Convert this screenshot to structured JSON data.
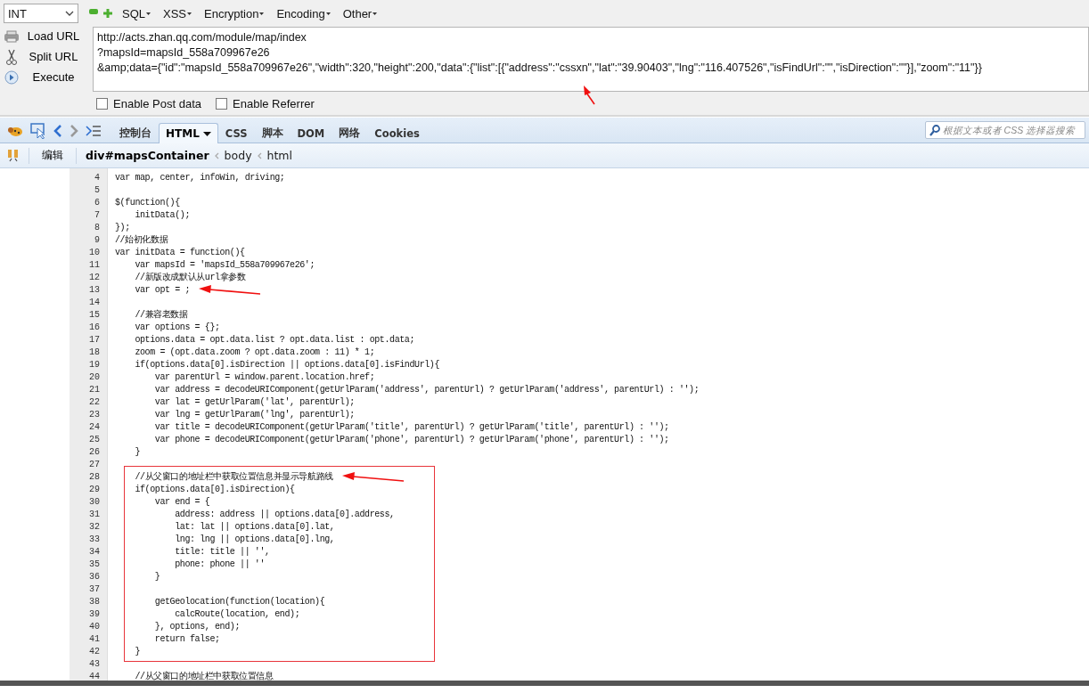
{
  "hackbar": {
    "select": {
      "value": "INT"
    },
    "menus": [
      "SQL",
      "XSS",
      "Encryption",
      "Encoding",
      "Other"
    ],
    "actions": [
      {
        "label": "Load URL",
        "kind": "load"
      },
      {
        "label": "Split URL",
        "kind": "split"
      },
      {
        "label": "Execute",
        "kind": "execute"
      }
    ],
    "url_lines": [
      "http://acts.zhan.qq.com/module/map/index",
      "?mapsId=mapsId_558a709967e26",
      "&amp;data={\"id\":\"mapsId_558a709967e26\",\"width\":320,\"height\":200,\"data\":{\"list\":[{\"address\":\"cssxn\",\"lat\":\"39.90403\",\"lng\":\"116.407526\",\"isFindUrl\":\"\",\"isDirection\":\"\"}],\"zoom\":\"11\"}}"
    ],
    "url_arrow": true,
    "options": [
      {
        "label": "Enable Post data",
        "checked": false
      },
      {
        "label": "Enable Referrer",
        "checked": false
      }
    ]
  },
  "firebug": {
    "tabs": [
      {
        "label": "控制台",
        "selected": false,
        "dropdown": false
      },
      {
        "label": "HTML",
        "selected": true,
        "dropdown": true
      },
      {
        "label": "CSS",
        "selected": false,
        "dropdown": false
      },
      {
        "label": "脚本",
        "selected": false,
        "dropdown": false
      },
      {
        "label": "DOM",
        "selected": false,
        "dropdown": false
      },
      {
        "label": "网络",
        "selected": false,
        "dropdown": false
      },
      {
        "label": "Cookies",
        "selected": false,
        "dropdown": false
      }
    ],
    "search": {
      "placeholder": "根据文本或者 CSS 选择器搜索"
    },
    "edit_button": "编辑",
    "breadcrumbs": [
      {
        "label": "div#mapsContainer",
        "selected": true
      },
      {
        "label": "body",
        "selected": false
      },
      {
        "label": "html",
        "selected": false
      }
    ]
  },
  "code": [
    {
      "kind": "plain",
      "lines": [
        {
          "num": "4",
          "text": "var map, center, infoWin, driving;"
        },
        {
          "num": "5"
        },
        {
          "num": "6",
          "text": "$(function(){"
        },
        {
          "num": "7",
          "text": "    initData();"
        },
        {
          "num": "8",
          "text": "});"
        },
        {
          "num": "9",
          "text": "//始初化数据"
        },
        {
          "num": "10",
          "text": "var initData = function(){"
        },
        {
          "num": "11",
          "text": "    var mapsId = 'mapsId_558a709967e26';"
        },
        {
          "num": "12",
          "text": "    //新版改成默认从url拿参数"
        },
        {
          "num": "13",
          "text": "    var opt = ;",
          "arrow": true
        },
        {
          "num": "14"
        },
        {
          "num": "15",
          "text": "    //兼容老数据"
        },
        {
          "num": "16",
          "text": "    var options = {};"
        },
        {
          "num": "17",
          "text": "    options.data = opt.data.list ? opt.data.list : opt.data;"
        },
        {
          "num": "18",
          "text": "    zoom = (opt.data.zoom ? opt.data.zoom : 11) * 1;"
        },
        {
          "num": "19",
          "text": "    if(options.data[0].isDirection || options.data[0].isFindUrl){"
        },
        {
          "num": "20",
          "text": "        var parentUrl = window.parent.location.href;"
        },
        {
          "num": "21",
          "text": "        var address = decodeURIComponent(getUrlParam('address', parentUrl) ? getUrlParam('address', parentUrl) : '');"
        },
        {
          "num": "22",
          "text": "        var lat = getUrlParam('lat', parentUrl);"
        },
        {
          "num": "23",
          "text": "        var lng = getUrlParam('lng', parentUrl);"
        },
        {
          "num": "24",
          "text": "        var title = decodeURIComponent(getUrlParam('title', parentUrl) ? getUrlParam('title', parentUrl) : '');"
        },
        {
          "num": "25",
          "text": "        var phone = decodeURIComponent(getUrlParam('phone', parentUrl) ? getUrlParam('phone', parentUrl) : '');"
        },
        {
          "num": "26",
          "text": "    }"
        },
        {
          "num": "27"
        }
      ]
    },
    {
      "kind": "boxed",
      "lines": [
        {
          "num": "28",
          "text": "    //从父窗口的地址栏中获取位置信息并显示导航路线",
          "arrow": true
        },
        {
          "num": "29",
          "text": "    if(options.data[0].isDirection){"
        },
        {
          "num": "30",
          "text": "        var end = {"
        },
        {
          "num": "31",
          "text": "            address: address || options.data[0].address,"
        },
        {
          "num": "32",
          "text": "            lat: lat || options.data[0].lat,"
        },
        {
          "num": "33",
          "text": "            lng: lng || options.data[0].lng,"
        },
        {
          "num": "34",
          "text": "            title: title || '',"
        },
        {
          "num": "35",
          "text": "            phone: phone || ''"
        },
        {
          "num": "36",
          "text": "        }"
        },
        {
          "num": "37"
        },
        {
          "num": "38",
          "text": "        getGeolocation(function(location){"
        },
        {
          "num": "39",
          "text": "            calcRoute(location, end);"
        },
        {
          "num": "40",
          "text": "        }, options, end);"
        },
        {
          "num": "41",
          "text": "        return false;"
        },
        {
          "num": "42",
          "text": "    }"
        }
      ]
    },
    {
      "kind": "plain",
      "lines": [
        {
          "num": "43"
        },
        {
          "num": "44",
          "text": "    //从父窗口的地址栏中获取位置信息"
        }
      ]
    }
  ]
}
